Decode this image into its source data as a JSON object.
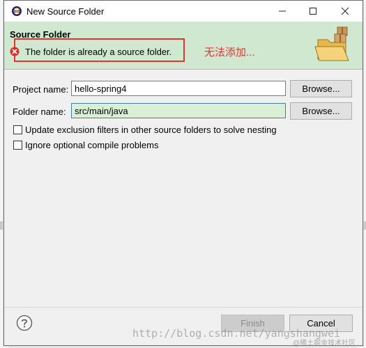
{
  "window": {
    "title": "New Source Folder",
    "minimize_icon": "minimize-icon",
    "maximize_icon": "maximize-icon",
    "close_icon": "close-icon"
  },
  "banner": {
    "title": "Source Folder",
    "message": "The folder is already a source folder.",
    "message_icon": "error-icon",
    "annotation": "无法添加..."
  },
  "form": {
    "project_name_label": "Project name:",
    "project_name_value": "hello-spring4",
    "folder_name_label": "Folder name:",
    "folder_name_value": "src/main/java",
    "browse_label": "Browse...",
    "option_update_exclusion": "Update exclusion filters in other source folders to solve nesting",
    "option_ignore_optional": "Ignore optional compile problems"
  },
  "footer": {
    "finish_label": "Finish",
    "cancel_label": "Cancel",
    "help_icon": "help-icon"
  },
  "watermark": {
    "url": "http://blog.csdn.net/yangshangwei",
    "credit": "@稀土掘金技术社区"
  },
  "colors": {
    "banner_bg": "#cfe8cf",
    "error_red": "#e3342f",
    "focus_field_bg": "#d9f0d6"
  }
}
